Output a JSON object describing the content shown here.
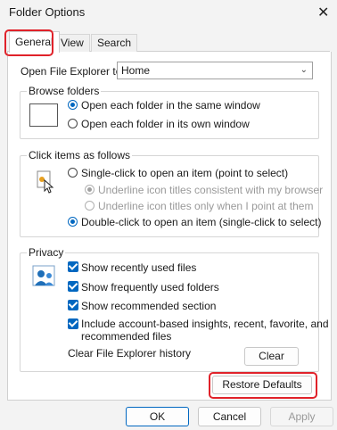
{
  "window": {
    "title": "Folder Options",
    "close_glyph": "✕"
  },
  "tabs": [
    {
      "label": "General",
      "active": true
    },
    {
      "label": "View",
      "active": false
    },
    {
      "label": "Search",
      "active": false
    }
  ],
  "open_explorer": {
    "label": "Open File Explorer to:",
    "value": "Home"
  },
  "browse_folders": {
    "title": "Browse folders",
    "options": [
      {
        "label": "Open each folder in the same window",
        "checked": true
      },
      {
        "label": "Open each folder in its own window",
        "checked": false
      }
    ]
  },
  "click_items": {
    "title": "Click items as follows",
    "single_click": "Single-click to open an item (point to select)",
    "underline_consistent": "Underline icon titles consistent with my browser",
    "underline_point": "Underline icon titles only when I point at them",
    "double_click": "Double-click to open an item (single-click to select)"
  },
  "privacy": {
    "title": "Privacy",
    "show_recent_files": "Show recently used files",
    "show_frequent_folders": "Show frequently used folders",
    "show_recommended": "Show recommended section",
    "include_insights_line1": "Include account-based insights, recent, favorite, and",
    "include_insights_line2": "recommended files",
    "clear_history_label": "Clear File Explorer history",
    "clear_button": "Clear"
  },
  "restore_defaults": "Restore Defaults",
  "footer": {
    "ok": "OK",
    "cancel": "Cancel",
    "apply": "Apply"
  },
  "colors": {
    "accent": "#0067c0",
    "highlight_box": "#e0222a"
  }
}
